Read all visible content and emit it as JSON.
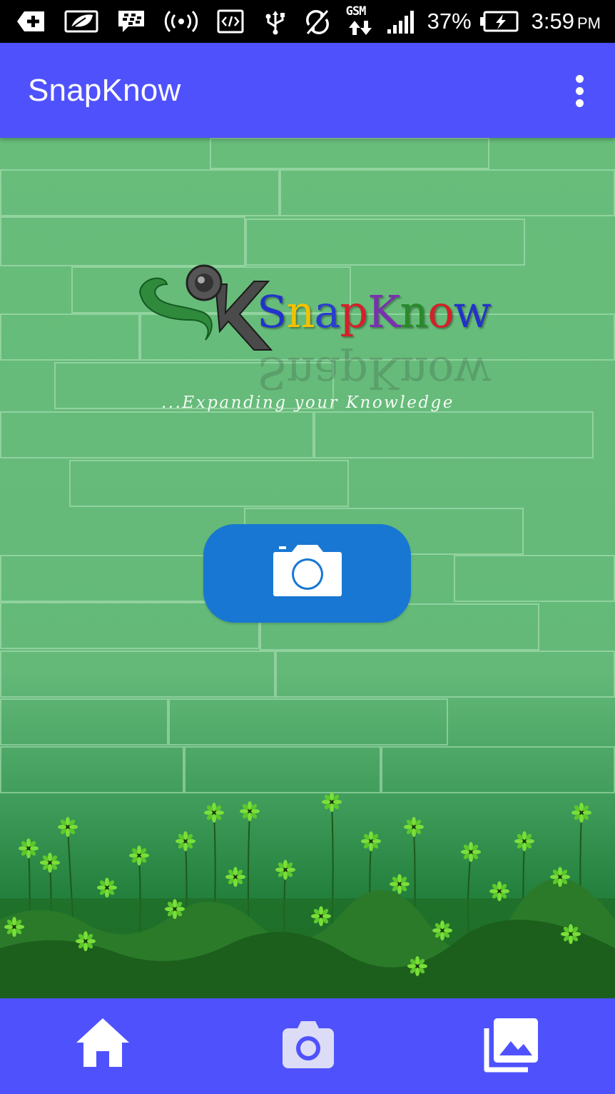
{
  "status_bar": {
    "battery_percent": "37%",
    "time": "3:59",
    "ampm": "PM",
    "network_label": "GSM",
    "icons": [
      "add-box-icon",
      "leaf-icon",
      "blackberry-messenger-icon",
      "wireless-signal-icon",
      "code-icon",
      "usb-icon",
      "sync-disabled-icon",
      "gsm-data-icon",
      "cell-signal-icon",
      "battery-charging-icon"
    ]
  },
  "app_bar": {
    "title": "SnapKnow",
    "overflow_icon": "more-vert-icon"
  },
  "logo": {
    "wordmark": "SnapKnow",
    "tagline": "...Expanding your Knowledge"
  },
  "main": {
    "camera_button_icon": "camera-icon"
  },
  "bottom_nav": {
    "items": [
      {
        "icon": "home-icon"
      },
      {
        "icon": "camera-icon"
      },
      {
        "icon": "gallery-icon"
      }
    ]
  },
  "colors": {
    "primary": "#4f52fc",
    "camera_button": "#1877d2",
    "background_green": "#66bb78",
    "status_bar": "#000000"
  }
}
